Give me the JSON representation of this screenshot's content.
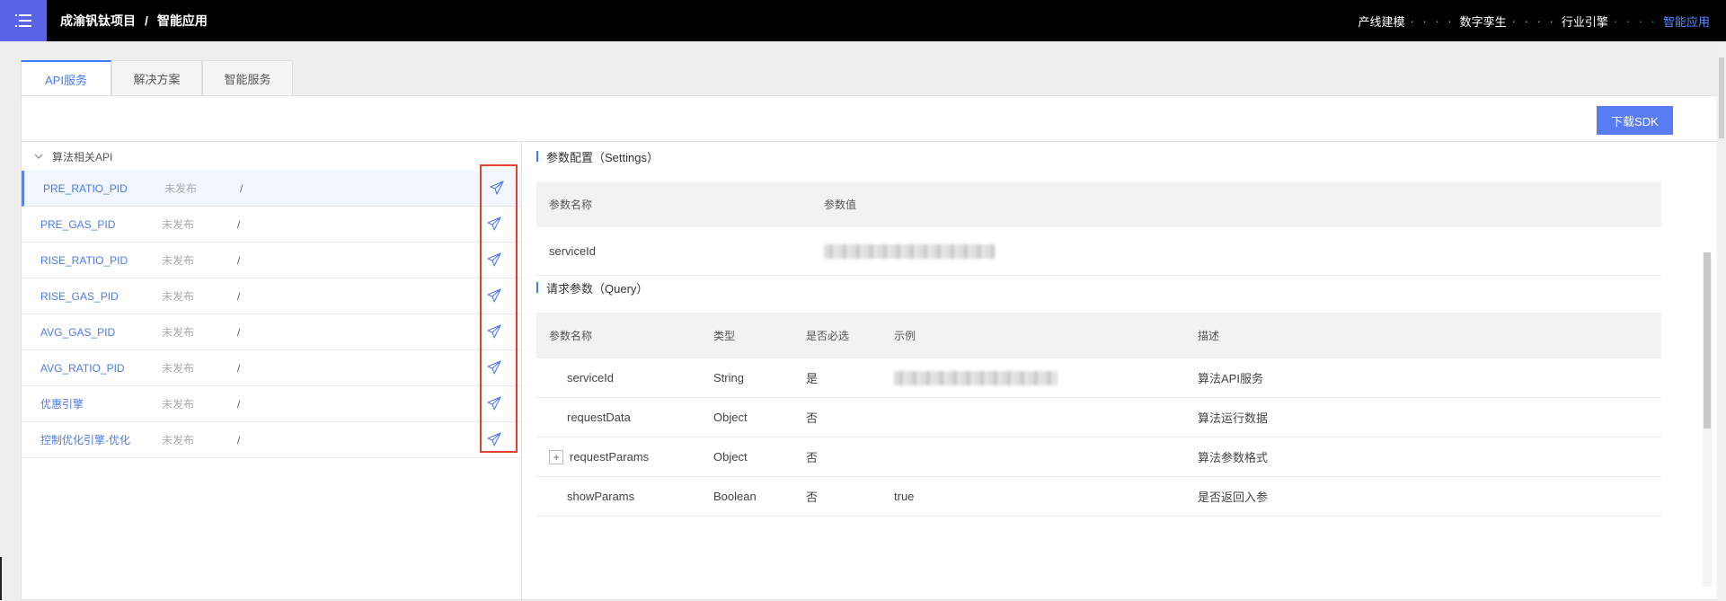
{
  "header": {
    "project": "成渝钒钛项目",
    "separator": "/",
    "page": "智能应用",
    "nav": [
      "产线建模",
      "数字孪生",
      "行业引擎",
      "智能应用"
    ],
    "nav_dots": "· · · ·"
  },
  "tabs": [
    "API服务",
    "解决方案",
    "智能服务"
  ],
  "toolbar": {
    "sdk_label": "下载SDK"
  },
  "left_list": {
    "group_label": "算法相关API",
    "items": [
      {
        "name": "PRE_RATIO_PID",
        "status": "未发布",
        "extra": "/"
      },
      {
        "name": "PRE_GAS_PID",
        "status": "未发布",
        "extra": "/"
      },
      {
        "name": "RISE_RATIO_PID",
        "status": "未发布",
        "extra": "/"
      },
      {
        "name": "RISE_GAS_PID",
        "status": "未发布",
        "extra": "/"
      },
      {
        "name": "AVG_GAS_PID",
        "status": "未发布",
        "extra": "/"
      },
      {
        "name": "AVG_RATIO_PID",
        "status": "未发布",
        "extra": "/"
      },
      {
        "name": "优惠引擎",
        "status": "未发布",
        "extra": "/"
      },
      {
        "name": "控制优化引擎-优化",
        "status": "未发布",
        "extra": "/"
      }
    ]
  },
  "settings": {
    "title": "参数配置（Settings）",
    "col_name": "参数名称",
    "col_value": "参数值",
    "row_name": "serviceId"
  },
  "query": {
    "title": "请求参数（Query）",
    "columns": [
      "参数名称",
      "类型",
      "是否必选",
      "示例",
      "描述"
    ],
    "rows": [
      {
        "name": "serviceId",
        "type": "String",
        "required": "是",
        "example": "",
        "desc": "算法API服务"
      },
      {
        "name": "requestData",
        "type": "Object",
        "required": "否",
        "example": "",
        "desc": "算法运行数据"
      },
      {
        "name": "requestParams",
        "type": "Object",
        "required": "否",
        "example": "",
        "desc": "算法参数格式"
      },
      {
        "name": "showParams",
        "type": "Boolean",
        "required": "否",
        "example": "true",
        "desc": "是否返回入参"
      }
    ],
    "expand_symbol": "+"
  },
  "icons": {
    "menu": "menu-icon",
    "chevron": "chevron-down-icon",
    "send": "send-icon"
  },
  "colors": {
    "accent": "#3f7bff",
    "menu_bg": "#5a63e8",
    "highlight_box": "#e2432c"
  }
}
